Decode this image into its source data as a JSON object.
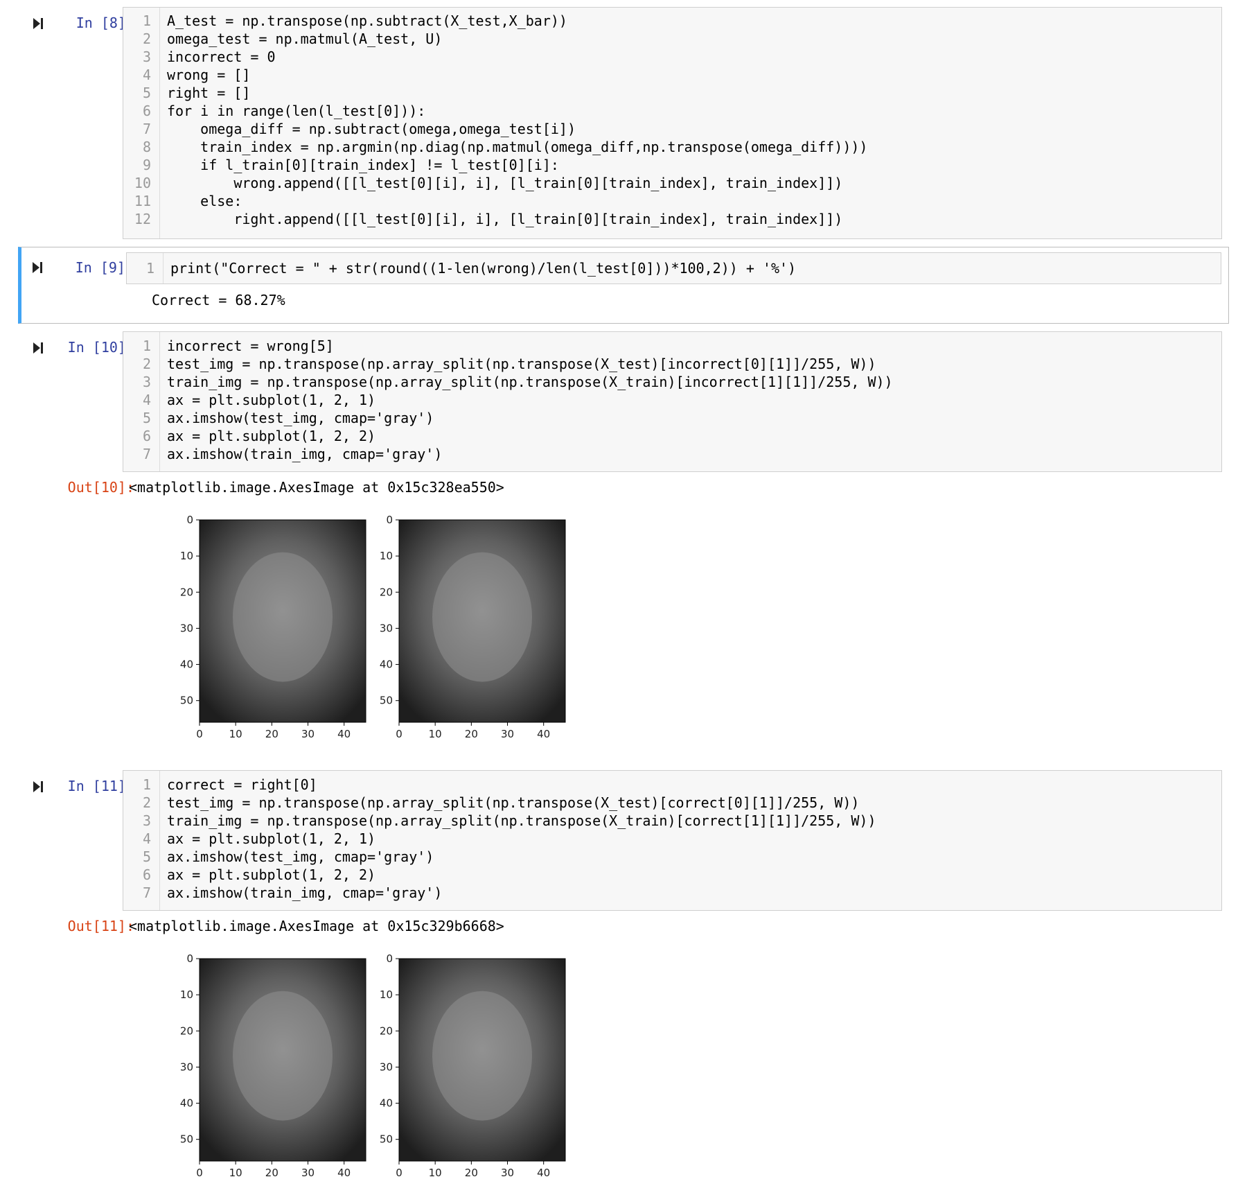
{
  "cells": [
    {
      "prompt": "In [8]:",
      "lines": [
        "A_test = np.transpose(np.subtract(X_test,X_bar))",
        "omega_test = np.matmul(A_test, U)",
        "incorrect = 0",
        "wrong = []",
        "right = []",
        "for i in range(len(l_test[0])):",
        "    omega_diff = np.subtract(omega,omega_test[i])",
        "    train_index = np.argmin(np.diag(np.matmul(omega_diff,np.transpose(omega_diff))))",
        "    if l_train[0][train_index] != l_test[0][i]:",
        "        wrong.append([[l_test[0][i], i], [l_train[0][train_index], train_index]])",
        "    else:",
        "        right.append([[l_test[0][i], i], [l_train[0][train_index], train_index]])"
      ]
    },
    {
      "prompt": "In [9]:",
      "lines": [
        "print(\"Correct = \" + str(round((1-len(wrong)/len(l_test[0]))*100,2)) + '%')"
      ],
      "output": "Correct = 68.27%"
    },
    {
      "prompt": "In [10]:",
      "lines": [
        "incorrect = wrong[5]",
        "test_img = np.transpose(np.array_split(np.transpose(X_test)[incorrect[0][1]]/255, W))",
        "train_img = np.transpose(np.array_split(np.transpose(X_train)[incorrect[1][1]]/255, W))",
        "ax = plt.subplot(1, 2, 1)",
        "ax.imshow(test_img, cmap='gray')",
        "ax = plt.subplot(1, 2, 2)",
        "ax.imshow(train_img, cmap='gray')"
      ],
      "out_prompt": "Out[10]:",
      "output": "<matplotlib.image.AxesImage at 0x15c328ea550>"
    },
    {
      "prompt": "In [11]:",
      "lines": [
        "correct = right[0]",
        "test_img = np.transpose(np.array_split(np.transpose(X_test)[correct[0][1]]/255, W))",
        "train_img = np.transpose(np.array_split(np.transpose(X_train)[correct[1][1]]/255, W))",
        "ax = plt.subplot(1, 2, 1)",
        "ax.imshow(test_img, cmap='gray')",
        "ax = plt.subplot(1, 2, 2)",
        "ax.imshow(train_img, cmap='gray')"
      ],
      "out_prompt": "Out[11]:",
      "output": "<matplotlib.image.AxesImage at 0x15c329b6668>"
    }
  ],
  "chart_data": [
    {
      "type": "image",
      "subplot": "1,2,1",
      "cmap": "gray",
      "yticks": [
        0,
        10,
        20,
        30,
        40,
        50
      ],
      "xticks": [
        0,
        10,
        20,
        30,
        40
      ],
      "ylim": [
        0,
        56
      ],
      "xlim": [
        0,
        46
      ]
    },
    {
      "type": "image",
      "subplot": "1,2,2",
      "cmap": "gray",
      "yticks": [
        0,
        10,
        20,
        30,
        40,
        50
      ],
      "xticks": [
        0,
        10,
        20,
        30,
        40
      ],
      "ylim": [
        0,
        56
      ],
      "xlim": [
        0,
        46
      ]
    },
    {
      "type": "image",
      "subplot": "1,2,1",
      "cmap": "gray",
      "yticks": [
        0,
        10,
        20,
        30,
        40,
        50
      ],
      "xticks": [
        0,
        10,
        20,
        30,
        40
      ],
      "ylim": [
        0,
        56
      ],
      "xlim": [
        0,
        46
      ]
    },
    {
      "type": "image",
      "subplot": "1,2,2",
      "cmap": "gray",
      "yticks": [
        0,
        10,
        20,
        30,
        40,
        50
      ],
      "xticks": [
        0,
        10,
        20,
        30,
        40
      ],
      "ylim": [
        0,
        56
      ],
      "xlim": [
        0,
        46
      ]
    }
  ],
  "colors": {
    "prompt_in": "#303f9f",
    "prompt_out": "#d84315",
    "selected_bar": "#42a5f5",
    "keyword": "#008000",
    "string": "#ba2121",
    "operator": "#aa22ff"
  },
  "icons": {
    "run": "run-cell-icon"
  }
}
